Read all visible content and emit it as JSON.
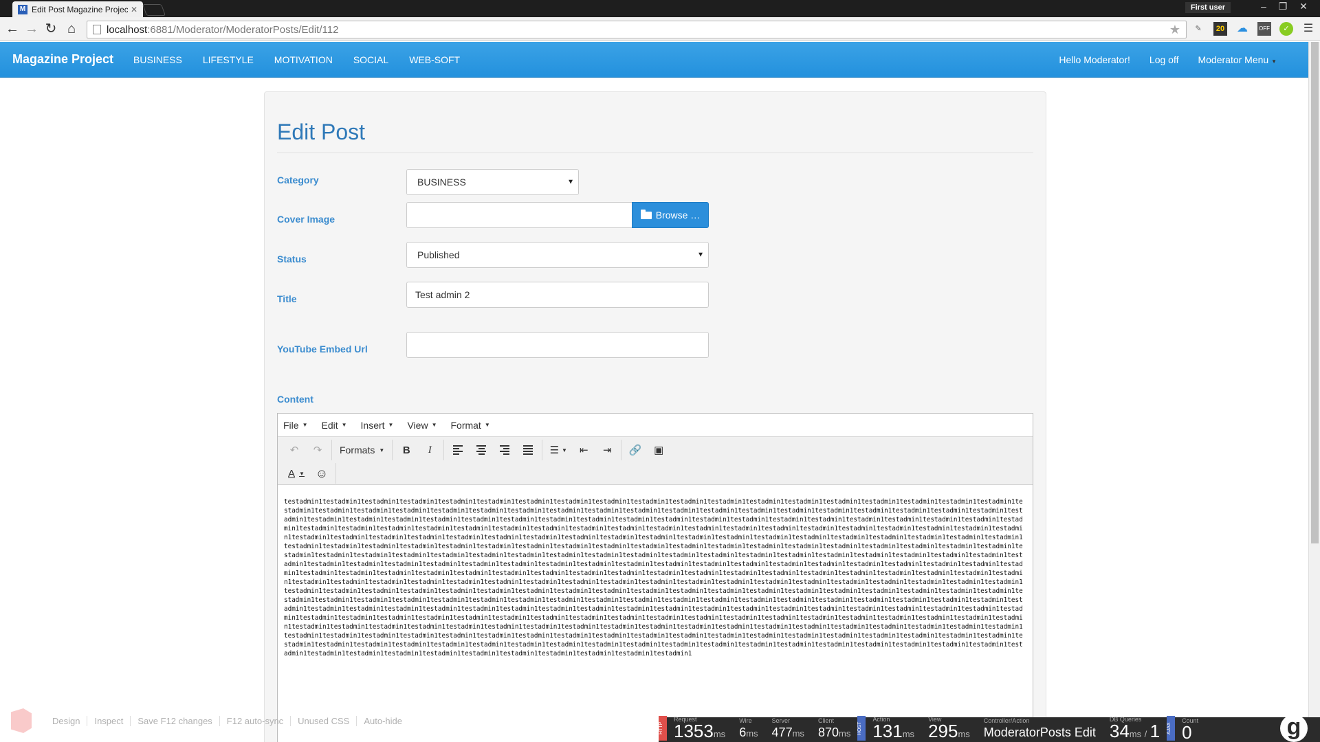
{
  "browser": {
    "tab_title": "Edit Post Magazine Projec",
    "favicon": "M",
    "profile": "First user",
    "url_host": "localhost",
    "url_rest": ":6881/Moderator/ModeratorPosts/Edit/112",
    "ext_badge": "20",
    "ext_off": "OFF"
  },
  "navbar": {
    "brand": "Magazine Project",
    "links": [
      "BUSINESS",
      "LIFESTYLE",
      "MOTIVATION",
      "SOCIAL",
      "WEB-SOFT"
    ],
    "greeting": "Hello Moderator!",
    "logoff": "Log off",
    "menu": "Moderator Menu"
  },
  "form": {
    "heading": "Edit Post",
    "category_label": "Category",
    "category_value": "BUSINESS",
    "cover_label": "Cover Image",
    "browse_label": "Browse …",
    "status_label": "Status",
    "status_value": "Published",
    "title_label": "Title",
    "title_value": "Test admin 2",
    "youtube_label": "YouTube Embed Url",
    "youtube_value": "",
    "content_label": "Content"
  },
  "editor": {
    "menus": [
      "File",
      "Edit",
      "Insert",
      "View",
      "Format"
    ],
    "formats_label": "Formats",
    "bold": "B",
    "italic": "I",
    "font_color": "A",
    "content_text": "testadmin1testadmin1testadmin1testadmin1testadmin1testadmin1testadmin1testadmin1testadmin1testadmin1testadmin1testadmin1testadmin1testadmin1testadmin1testadmin1testadmin1testadmin1testadmin1testadmin1testadmin1testadmin1testadmin1testadmin1testadmin1testadmin1testadmin1testadmin1testadmin1testadmin1testadmin1testadmin1testadmin1testadmin1testadmin1testadmin1testadmin1testadmin1testadmin1testadmin1testadmin1testadmin1testadmin1testadmin1testadmin1testadmin1testadmin1testadmin1testadmin1testadmin1testadmin1testadmin1testadmin1testadmin1testadmin1testadmin1testadmin1testadmin1testadmin1testadmin1testadmin1testadmin1testadmin1testadmin1testadmin1testadmin1testadmin1testadmin1testadmin1testadmin1testadmin1testadmin1testadmin1testadmin1testadmin1testadmin1testadmin1testadmin1testadmin1testadmin1testadmin1testadmin1testadmin1testadmin1testadmin1testadmin1testadmin1testadmin1testadmin1testadmin1testadmin1testadmin1testadmin1testadmin1testadmin1testadmin1testadmin1testadmin1testadmin1testadmin1testadmin1testadmin1testadmin1testadmin1testadmin1testadmin1testadmin1testadmin1testadmin1testadmin1testadmin1testadmin1testadmin1testadmin1testadmin1testadmin1testadmin1testadmin1testadmin1testadmin1testadmin1testadmin1testadmin1testadmin1testadmin1testadmin1testadmin1testadmin1testadmin1testadmin1testadmin1testadmin1testadmin1testadmin1testadmin1testadmin1testadmin1testadmin1testadmin1testadmin1testadmin1testadmin1testadmin1testadmin1testadmin1testadmin1testadmin1testadmin1testadmin1testadmin1testadmin1testadmin1testadmin1testadmin1testadmin1testadmin1testadmin1testadmin1testadmin1testadmin1testadmin1testadmin1testadmin1testadmin1testadmin1testadmin1testadmin1testadmin1testadmin1testadmin1testadmin1testadmin1testadmin1testadmin1testadmin1testadmin1testadmin1testadmin1testadmin1testadmin1testadmin1testadmin1testadmin1testadmin1testadmin1testadmin1testadmin1testadmin1testadmin1testadmin1testadmin1testadmin1testadmin1testadmin1testadmin1testadmin1testadmin1testadmin1testadmin1testadmin1testadmin1testadmin1testadmin1testadmin1testadmin1testadmin1testadmin1testadmin1testadmin1testadmin1testadmin1testadmin1testadmin1testadmin1testadmin1testadmin1testadmin1testadmin1testadmin1testadmin1testadmin1testadmin1testadmin1testadmin1testadmin1testadmin1testadmin1testadmin1testadmin1testadmin1testadmin1testadmin1testadmin1testadmin1testadmin1testadmin1testadmin1testadmin1testadmin1testadmin1testadmin1testadmin1testadmin1testadmin1testadmin1testadmin1testadmin1testadmin1testadmin1testadmin1testadmin1testadmin1testadmin1testadmin1testadmin1testadmin1testadmin1testadmin1testadmin1testadmin1testadmin1testadmin1testadmin1testadmin1testadmin1testadmin1testadmin1testadmin1testadmin1testadmin1testadmin1testadmin1testadmin1testadmin1testadmin1testadmin1testadmin1testadmin1testadmin1testadmin1testadmin1testadmin1testadmin1testadmin1testadmin1testadmin1testadmin1testadmin1testadmin1testadmin1testadmin1testadmin1testadmin1testadmin1testadmin1testadmin1testadmin1testadmin1testadmin1testadmin1testadmin1testadmin1testadmin1testadmin1testadmin1testadmin1testadmin1testadmin1testadmin1testadmin1testadmin1testadmin1testadmin1testadmin1testadmin1testadmin1testadmin1testadmin1testadmin1testadmin1testadmin1testadmin1testadmin1testadmin1testadmin1testadmin1testadmin1testadmin1testadmin1testadmin1testadmin1testadmin1testadmin1testadmin1testadmin1testadmin1testadmin1"
  },
  "web_essentials": [
    "Design",
    "Inspect",
    "Save F12 changes",
    "F12 auto-sync",
    "Unused CSS",
    "Auto-hide"
  ],
  "glimpse": {
    "http_tag": "HTTP",
    "host_tag": "HOST",
    "ajax_tag": "AJAX",
    "request_label": "Request",
    "request_value": "1353",
    "request_unit": "ms",
    "wire_label": "Wire",
    "wire_value": "6",
    "wire_unit": "ms",
    "server_label": "Server",
    "server_value": "477",
    "server_unit": "ms",
    "client_label": "Client",
    "client_value": "870",
    "client_unit": "ms",
    "action_label": "Action",
    "action_value": "131",
    "action_unit": "ms",
    "view_label": "View",
    "view_value": "295",
    "view_unit": "ms",
    "controller_label": "Controller/Action",
    "controller_value": "ModeratorPosts Edit",
    "db_label": "DB Queries",
    "db_time": "34",
    "db_unit": "ms",
    "db_sep": "/",
    "db_count": "1",
    "ajax_label": "Count",
    "ajax_count": "0"
  }
}
